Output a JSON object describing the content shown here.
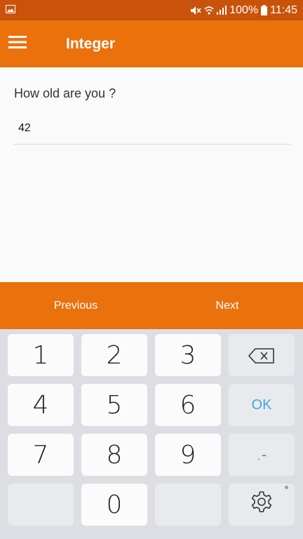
{
  "status_bar": {
    "battery": "100%",
    "time": "11:45"
  },
  "app_bar": {
    "title": "Integer"
  },
  "form": {
    "question": "How old are you ?",
    "answer_value": "42"
  },
  "navigation": {
    "previous": "Previous",
    "next": "Next"
  },
  "keyboard": {
    "keys": [
      "1",
      "2",
      "3",
      "4",
      "5",
      "6",
      "7",
      "8",
      "9",
      "0"
    ],
    "ok": "OK",
    "symbols": ".-"
  },
  "colors": {
    "status_bar": "#c9530a",
    "primary": "#ea710c",
    "ok_key": "#3ea8db"
  }
}
